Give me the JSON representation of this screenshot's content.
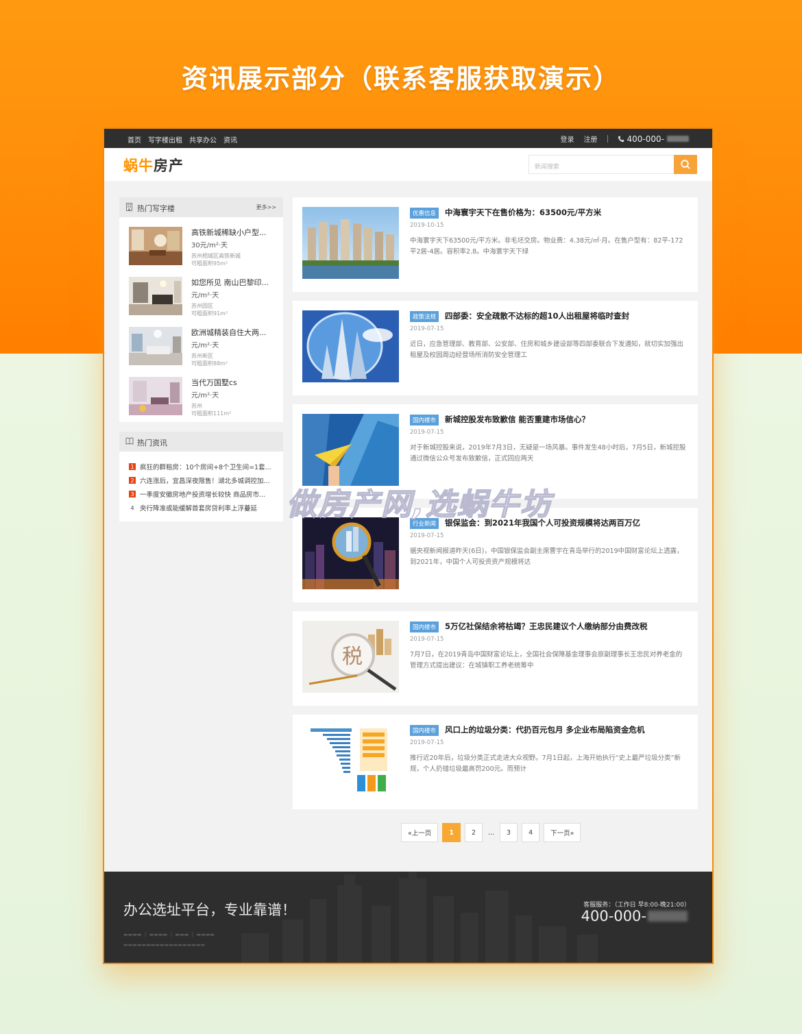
{
  "banner": {
    "title": "资讯展示部分（联系客服获取演示）"
  },
  "topbar": {
    "nav": [
      "首页",
      "写字楼出租",
      "共享办公",
      "资讯"
    ],
    "login": "登录",
    "register": "注册",
    "phone": "400-000-"
  },
  "header": {
    "logo_part1": "蜗牛",
    "logo_part2": "房产",
    "search_placeholder": "新闻搜索"
  },
  "hot_offices": {
    "title": "热门写字楼",
    "more": "更多>>",
    "items": [
      {
        "name": "高铁新城稀缺小户型...",
        "price": "30元/m²·天",
        "location": "苏州相城区高铁新城",
        "area": "可租面积95m²"
      },
      {
        "name": "如您所见 南山巴黎印...",
        "price": "元/m²·天",
        "location": "苏州园区",
        "area": "可租面积91m²"
      },
      {
        "name": "欧洲城精装自住大两...",
        "price": "元/m²·天",
        "location": "苏州新区",
        "area": "可租面积88m²"
      },
      {
        "name": "当代万国墅cs",
        "price": "元/m²·天",
        "location": "苏州",
        "area": "可租面积111m²"
      }
    ]
  },
  "hot_news": {
    "title": "热门资讯",
    "items": [
      {
        "num": "1",
        "text": "疯狂的群租房：10个房间+8个卫生间=1套..."
      },
      {
        "num": "2",
        "text": "六连涨后，宜昌深夜限售！湖北多城调控加..."
      },
      {
        "num": "3",
        "text": "一季度安徽房地产投资增长较快 商品房市..."
      },
      {
        "num": "4",
        "text": "央行降准或能缓解首套房贷利率上浮蔓延"
      }
    ]
  },
  "articles": [
    {
      "tag": "优惠信息",
      "title": "中海寰宇天下在售价格为：63500元/平方米",
      "date": "2019-10-15",
      "desc": "中海寰宇天下63500元/平方米。非毛坯交房。物业费：4.38元/㎡·月。在售户型有：82平-172平2居-4居。容积率2.8。中海寰宇天下绿"
    },
    {
      "tag": "政策法规",
      "title": "四部委：安全疏散不达标的超10人出租屋将临时查封",
      "date": "2019-07-15",
      "desc": "近日，应急管理部、教育部、公安部、住房和城乡建设部等四部委联合下发通知，就切实加强出租屋及校园周边经营场所消防安全管理工"
    },
    {
      "tag": "国内楼市",
      "title": "新城控股发布致歉信 能否重建市场信心？",
      "date": "2019-07-15",
      "desc": "对于新城控股来说，2019年7月3日，无疑是一场风暴。事件发生48小时后，7月5日，新城控股通过微信公众号发布致歉信，正式回应两天"
    },
    {
      "tag": "行业新闻",
      "title": "银保监会：到2021年我国个人可投资规模将达两百万亿",
      "date": "2019-07-15",
      "desc": "据央视新闻报道昨天(6日)，中国银保监会副主席曹宇在青岛举行的2019中国财富论坛上透露，到2021年，中国个人可投资资产规模将达"
    },
    {
      "tag": "国内楼市",
      "title": "5万亿社保结余将枯竭？王忠民建议个人缴纳部分由费改税",
      "date": "2019-07-15",
      "desc": "7月7日，在2019青岛中国财富论坛上，全国社会保障基金理事会原副理事长王忠民对养老金的管理方式提出建议：在城镇职工养老统筹中"
    },
    {
      "tag": "国内楼市",
      "title": "风口上的垃圾分类：代扔百元包月 多企业布局陷资金危机",
      "date": "2019-07-15",
      "desc": "推行近20年后，垃圾分类正式走进大众视野。7月1日起，上海开始执行“史上最严垃圾分类”新规，个人扔错垃圾最高罚200元。而预计"
    }
  ],
  "pagination": {
    "prev": "«上一页",
    "pages": [
      "1",
      "2",
      "3",
      "4"
    ],
    "dots": "...",
    "next": "下一页»"
  },
  "footer": {
    "slogan": "办公选址平台，专业靠谱！",
    "service_label": "客服服务：（工作日 早8:00-晚21:00）",
    "service_phone": "400-000-"
  },
  "watermark": "做房产网,选蜗牛坊",
  "colors": {
    "accent": "#ff9400",
    "tag": "#5aa0dc",
    "dark": "#2f2f2f",
    "page_active": "#f7a832"
  }
}
